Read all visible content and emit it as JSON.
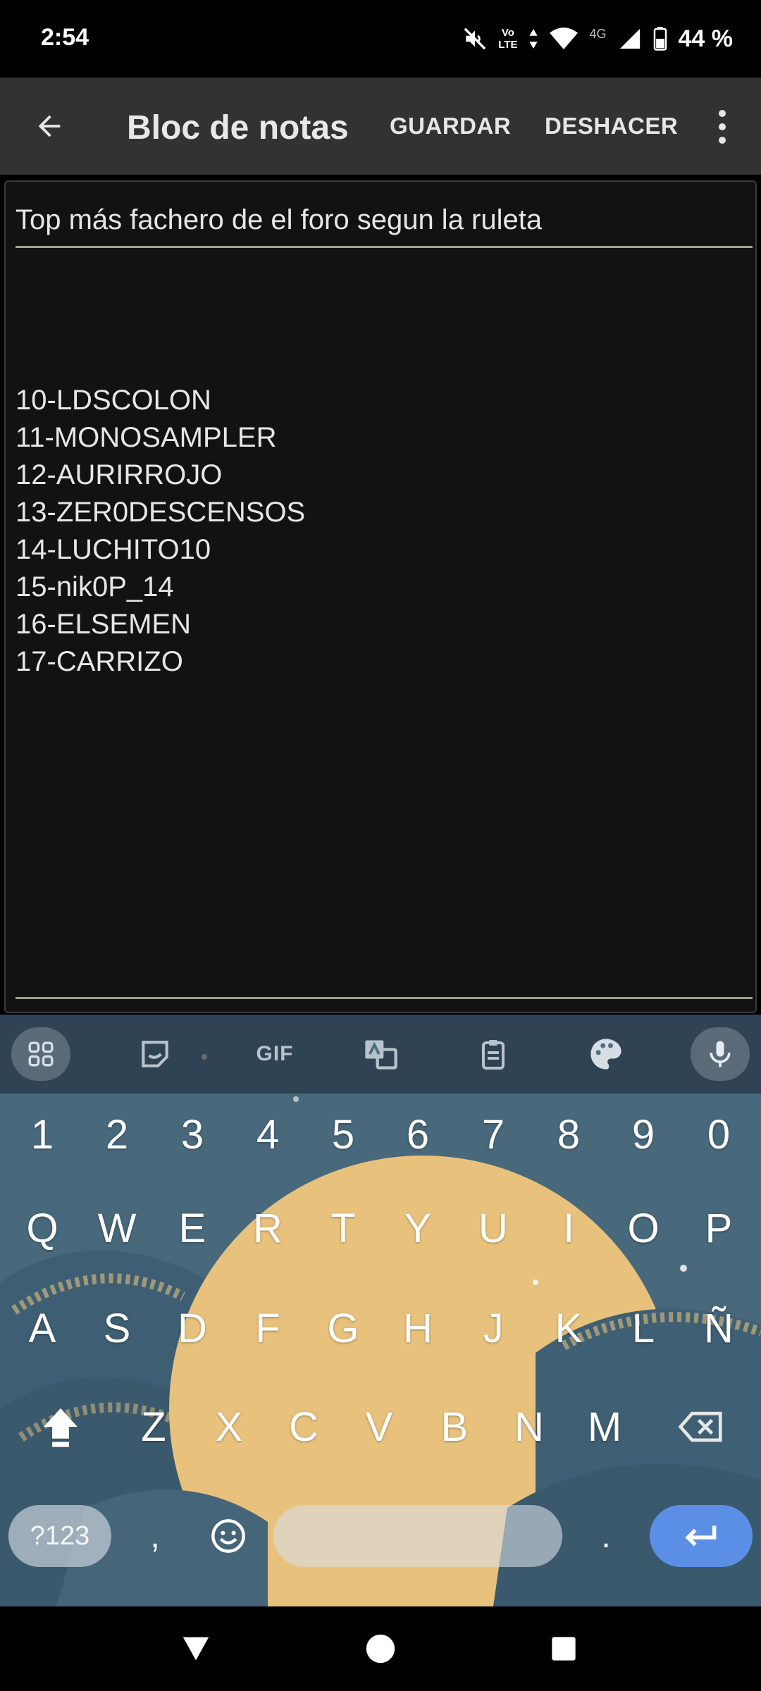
{
  "status_bar": {
    "time": "2:54",
    "volte_line1": "Vo",
    "volte_line2": "LTE",
    "network_label": "4G",
    "battery": "44 %"
  },
  "app_bar": {
    "title": "Bloc de notas",
    "save_label": "GUARDAR",
    "undo_label": "DESHACER"
  },
  "note": {
    "title": "Top más fachero de el foro segun la ruleta",
    "body_lines": [
      "",
      "",
      "10-LDSCOLON",
      "11-MONOSAMPLER",
      "12-AURIRROJO",
      "13-ZER0DESCENSOS",
      "14-LUCHITO10",
      "15-nik0P_14",
      "16-ELSEMEN",
      "17-CARRIZO"
    ]
  },
  "keyboard": {
    "toolbar": {
      "gif_label": "GIF"
    },
    "number_row": [
      "1",
      "2",
      "3",
      "4",
      "5",
      "6",
      "7",
      "8",
      "9",
      "0"
    ],
    "row1": [
      "Q",
      "W",
      "E",
      "R",
      "T",
      "Y",
      "U",
      "I",
      "O",
      "P"
    ],
    "row2": [
      "A",
      "S",
      "D",
      "F",
      "G",
      "H",
      "J",
      "K",
      "L",
      "Ñ"
    ],
    "row3": [
      "Z",
      "X",
      "C",
      "V",
      "B",
      "N",
      "M"
    ],
    "symbols_label": "?123",
    "comma": ",",
    "period": ".",
    "enter_color": "#5b8fe6"
  },
  "colors": {
    "app_bar": "#323232",
    "note_bg": "#121212",
    "underline": "#9aa58c"
  }
}
